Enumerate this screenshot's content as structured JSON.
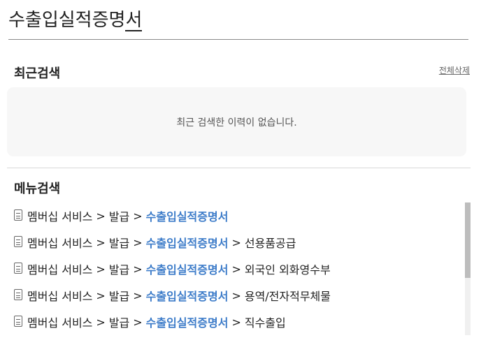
{
  "search": {
    "query_main": "수출입실적증명",
    "query_last": "서"
  },
  "recent": {
    "title": "최근검색",
    "clear_all": "전체삭제",
    "empty_message": "최근 검색한 이력이 없습니다."
  },
  "menu": {
    "title": "메뉴검색",
    "separator": ">",
    "items": [
      {
        "p1": "멤버십 서비스",
        "p2": "발급",
        "match": "수출입실적증명서",
        "tail": ""
      },
      {
        "p1": "멤버십 서비스",
        "p2": "발급",
        "match": "수출입실적증명서",
        "tail": "선용품공급"
      },
      {
        "p1": "멤버십 서비스",
        "p2": "발급",
        "match": "수출입실적증명서",
        "tail": "외국인 외화영수부"
      },
      {
        "p1": "멤버십 서비스",
        "p2": "발급",
        "match": "수출입실적증명서",
        "tail": "용역/전자적무체물"
      },
      {
        "p1": "멤버십 서비스",
        "p2": "발급",
        "match": "수출입실적증명서",
        "tail": "직수출입"
      }
    ]
  },
  "icons": {
    "item_icon": "document-icon"
  },
  "colors": {
    "highlight": "#3d7cc9",
    "divider": "#8a8a8a",
    "panel": "#f7f7f7"
  }
}
